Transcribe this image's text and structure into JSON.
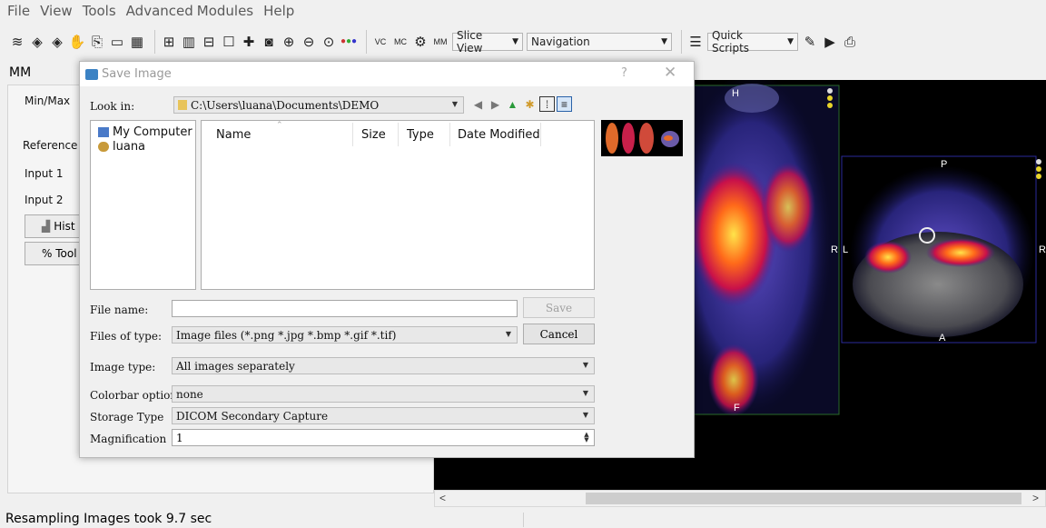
{
  "menu": [
    "File",
    "View",
    "Tools",
    "Advanced",
    "Modules",
    "Help"
  ],
  "toolbar": {
    "icons_group1": [
      "layers-icon",
      "brain-icon",
      "brain2-icon",
      "hand-icon",
      "copy-icon",
      "window-icon",
      "film-icon"
    ],
    "icons_group2": [
      "grid-2x2-icon",
      "columns-icon",
      "layout-icon",
      "square-icon",
      "crosshair-icon",
      "camera-icon",
      "zoom-in-icon",
      "zoom-out-icon",
      "zoom-fit-icon",
      "dots-color-icon"
    ],
    "icons_group3": [
      "vc-icon",
      "mc-icon",
      "gear-icon",
      "mm-icon"
    ],
    "slice_view_label": "Slice View",
    "navigation_label": "Navigation",
    "quick_scripts_label": "Quick Scripts"
  },
  "panel": {
    "title": "MM",
    "minmax": "Min/Max",
    "reference": "Reference",
    "input1": "Input 1",
    "input2": "Input 2",
    "hist_btn": "Hist",
    "tool_btn": "% Tool"
  },
  "viewer": {
    "coronal_top": "H",
    "coronal_bottom": "F",
    "coronal_right": "R",
    "axial_top": "P",
    "axial_bottom": "A",
    "axial_left": "L",
    "axial_right": "R"
  },
  "status": "Resampling Images took 9.7 sec",
  "dialog": {
    "title": "Save Image",
    "help": "?",
    "close": "✕",
    "look_in_label": "Look in:",
    "look_in_value": "C:\\Users\\luana\\Documents\\DEMO",
    "places": [
      "My Computer",
      "luana"
    ],
    "columns": [
      "Name",
      "Size",
      "Type",
      "Date Modified"
    ],
    "file_name_label": "File name:",
    "file_name_value": "",
    "save_label": "Save",
    "files_of_type_label": "Files of type:",
    "files_of_type_value": "Image files (*.png *.jpg *.bmp *.gif *.tif)",
    "cancel_label": "Cancel",
    "image_type_label": "Image type:",
    "image_type_value": "All images separately",
    "colorbar_label": "Colorbar options",
    "colorbar_value": "none",
    "storage_label": "Storage Type",
    "storage_value": "DICOM Secondary Capture",
    "magnification_label": "Magnification",
    "magnification_value": "1"
  }
}
